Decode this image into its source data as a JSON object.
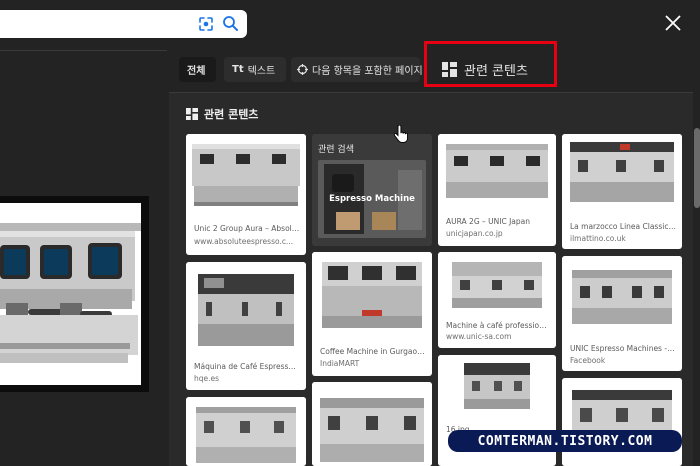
{
  "search": {
    "lens_icon": "google-lens-icon",
    "search_icon": "search-icon"
  },
  "close_icon": "close-icon",
  "tabs": [
    {
      "label": "전체",
      "active": true
    },
    {
      "prefix": "Tt",
      "label": "텍스트"
    },
    {
      "label": "다음 항목을 포함한 페이지",
      "icon": "page-search-icon"
    },
    {
      "label": "관련 콘텐츠",
      "icon": "grid-icon"
    }
  ],
  "panel": {
    "title": "관련 콘텐츠",
    "title_icon": "grid-icon"
  },
  "related_search": {
    "label": "관련 검색",
    "caption": "Espresso Machine"
  },
  "results": [
    {
      "title": "Unic 2 Group Aura – Absolute ...",
      "source": "www.absoluteespresso.c..."
    },
    {
      "title": "AURA 2G – UNIC Japan",
      "source": "unicjapan.co.jp"
    },
    {
      "title": "La marzocco Linea Classic - il ...",
      "source": "ilmattino.co.uk"
    },
    {
      "title": "Máquina de Café Espresso - ...",
      "source": "hqe.es"
    },
    {
      "title": "Coffee Machine in Gurgaon, ...",
      "source": "IndiaMART"
    },
    {
      "title": "Machine à café professionnell...",
      "source": "www.unic-sa.com"
    },
    {
      "title": "UNIC Espresso Machines - Ho...",
      "source": "Facebook"
    },
    {
      "title": "16.jpg",
      "source": ""
    }
  ],
  "watermark": "COMTERMAN.TISTORY.COM",
  "colors": {
    "background": "#232323",
    "panel": "#2a2a2a",
    "highlight": "#e60012",
    "watermark_bg": "#0a1a55"
  }
}
